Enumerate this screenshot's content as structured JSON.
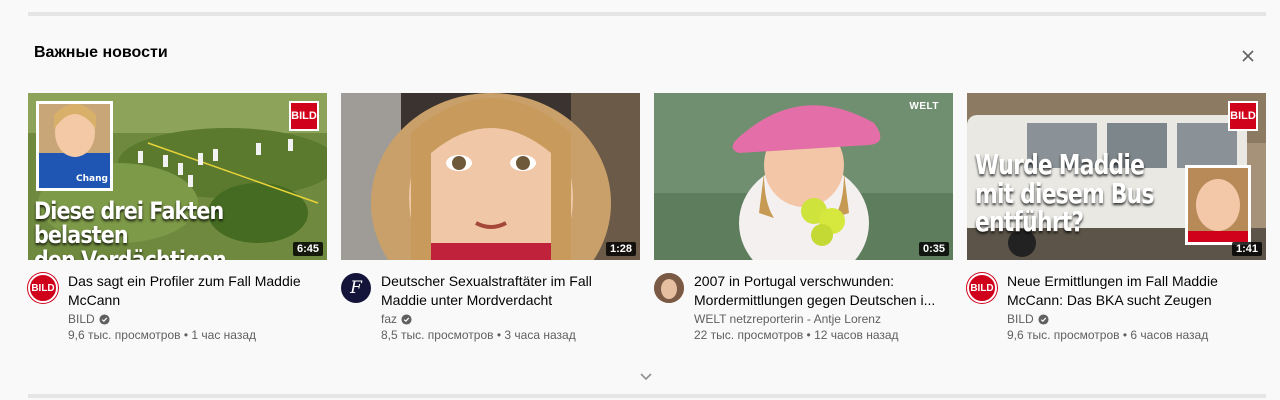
{
  "shelf": {
    "title": "Важные новости",
    "close_icon": "close-icon",
    "expand_icon": "chevron-down-icon"
  },
  "colors": {
    "bild_red": "#d0021b",
    "background": "#f9f9f9",
    "meta_text": "#606060"
  },
  "videos": [
    {
      "title": "Das sagt ein Profiler zum Fall Maddie McCann",
      "channel": "BILD",
      "verified": true,
      "views": "9,6 тыс. просмотров",
      "age": "1 час назад",
      "duration": "6:45",
      "thumb_overlay_line1": "Diese drei Fakten belasten",
      "thumb_overlay_line2": "den Verdächtigen",
      "thumb_logo": "BILD",
      "jersey_text": "Chang"
    },
    {
      "title": "Deutscher Sexualstraftäter im Fall Maddie unter Mordverdacht",
      "channel": "faz",
      "verified": true,
      "views": "8,5 тыс. просмотров",
      "age": "3 часа назад",
      "duration": "1:28",
      "avatar_letter": "F"
    },
    {
      "title": "2007 in Portugal verschwunden: Mordermittlungen gegen Deutschen i...",
      "channel": "WELT netzreporterin - Antje Lorenz",
      "verified": false,
      "views": "22 тыс. просмотров",
      "age": "12 часов назад",
      "duration": "0:35",
      "thumb_logo": "WELT"
    },
    {
      "title": "Neue Ermittlungen im Fall Maddie McCann: Das BKA sucht Zeugen",
      "channel": "BILD",
      "verified": true,
      "views": "9,6 тыс. просмотров",
      "age": "6 часов назад",
      "duration": "1:41",
      "thumb_overlay_line1": "Wurde Maddie",
      "thumb_overlay_line2": "mit diesem Bus",
      "thumb_overlay_line3": "entführt?",
      "thumb_logo": "BILD"
    }
  ]
}
